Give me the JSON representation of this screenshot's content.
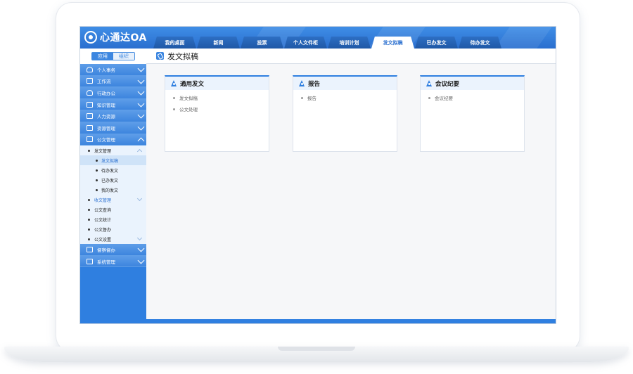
{
  "app": {
    "logo_text": "心通达OA"
  },
  "header": {
    "tabs": [
      {
        "label": "我的桌面",
        "active": false
      },
      {
        "label": "新闻",
        "active": false
      },
      {
        "label": "投票",
        "active": false
      },
      {
        "label": "个人文件柜",
        "active": false
      },
      {
        "label": "培训计划",
        "active": false
      },
      {
        "label": "发文拟稿",
        "active": true
      },
      {
        "label": "已办发文",
        "active": false
      },
      {
        "label": "待办发文",
        "active": false
      }
    ]
  },
  "sidebar": {
    "switch": {
      "app_label": "应用",
      "org_label": "组织"
    },
    "menu": [
      {
        "label": "个人事务",
        "icon": "person-icon"
      },
      {
        "label": "工作流",
        "icon": "workflow-icon"
      },
      {
        "label": "行政办公",
        "icon": "admin-icon"
      },
      {
        "label": "知识管理",
        "icon": "knowledge-icon"
      },
      {
        "label": "人力资源",
        "icon": "hr-icon"
      },
      {
        "label": "资源管理",
        "icon": "layers-icon"
      },
      {
        "label": "公文管理",
        "icon": "document-icon"
      }
    ],
    "submenu": {
      "send_group": "发文管理",
      "send_items": [
        "发文拟稿",
        "待办发文",
        "已办发文",
        "我的发文"
      ],
      "receive_group": "收文管理",
      "other_items": [
        "公文查询",
        "公文统计",
        "公文督办",
        "公文设置"
      ]
    },
    "menu_bottom": [
      {
        "label": "督察督办",
        "icon": "supervise-icon"
      },
      {
        "label": "系统管理",
        "icon": "monitor-icon"
      }
    ]
  },
  "main": {
    "page_title": "发文拟稿",
    "cards": [
      {
        "title": "通用发文",
        "links": [
          "发文拟稿",
          "公文处理"
        ]
      },
      {
        "title": "报告",
        "links": [
          "报告"
        ]
      },
      {
        "title": "会议纪要",
        "links": [
          "会议纪要"
        ]
      }
    ]
  },
  "colors": {
    "primary": "#2f7fe0",
    "header": "#3f8ee6",
    "submenu_bg": "#eaf3fd"
  }
}
